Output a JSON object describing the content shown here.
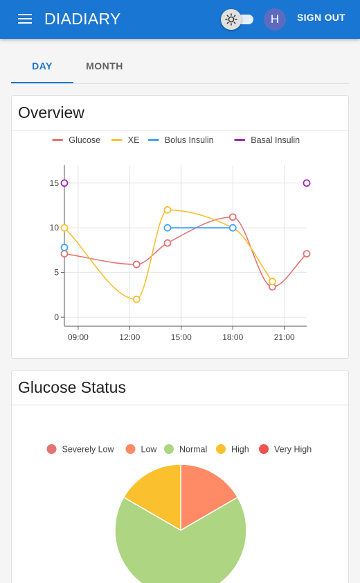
{
  "app": {
    "title": "DIADIARY",
    "avatar_initial": "H",
    "sign_out_label": "SIGN OUT",
    "primary_color": "#1976d2"
  },
  "icons": {
    "menu": "menu-icon",
    "theme": "sun-icon"
  },
  "tabs": [
    {
      "label": "DAY",
      "active": true
    },
    {
      "label": "MONTH",
      "active": false
    }
  ],
  "overview": {
    "title": "Overview"
  },
  "glucose_status": {
    "title": "Glucose Status"
  },
  "chart_data": [
    {
      "type": "line",
      "legend_position": "top",
      "grid": true,
      "x_ticks": [
        "09:00",
        "12:00",
        "15:00",
        "18:00",
        "21:00"
      ],
      "x_tick_hours": [
        9,
        12,
        15,
        18,
        21
      ],
      "xlim": [
        8.2,
        22.3
      ],
      "ylim": [
        -1,
        17
      ],
      "y_ticks": [
        0,
        5,
        10,
        15
      ],
      "series": [
        {
          "name": "Glucose",
          "color": "#e57373",
          "curve": "smooth",
          "points": [
            [
              8.2,
              7.1
            ],
            [
              12.4,
              5.9
            ],
            [
              14.2,
              8.3
            ],
            [
              18.0,
              11.2
            ],
            [
              20.3,
              3.4
            ],
            [
              22.3,
              7.1
            ]
          ]
        },
        {
          "name": "XE",
          "color": "#fbc02d",
          "curve": "smooth",
          "points": [
            [
              8.2,
              10.0
            ],
            [
              12.4,
              2.0
            ],
            [
              14.2,
              12.0
            ],
            [
              18.0,
              10.0
            ],
            [
              20.3,
              4.0
            ]
          ]
        },
        {
          "name": "Bolus Insulin",
          "color": "#42a5f5",
          "curve": "straight",
          "points": [
            [
              8.2,
              7.8
            ],
            [
              14.2,
              10.0
            ],
            [
              18.0,
              10.0
            ]
          ],
          "segments": [
            [
              1,
              2
            ]
          ]
        },
        {
          "name": "Basal Insulin",
          "color": "#9c27b0",
          "curve": "none",
          "points": [
            [
              8.2,
              15.0
            ],
            [
              22.3,
              15.0
            ]
          ]
        }
      ]
    },
    {
      "type": "pie",
      "legend_position": "top",
      "categories": [
        "Severely Low",
        "Low",
        "Normal",
        "High",
        "Very High"
      ],
      "colors": [
        "#e57373",
        "#ff8a65",
        "#aed581",
        "#fbc02d",
        "#ef5350"
      ],
      "values": [
        0,
        1,
        4,
        1,
        0
      ]
    }
  ]
}
